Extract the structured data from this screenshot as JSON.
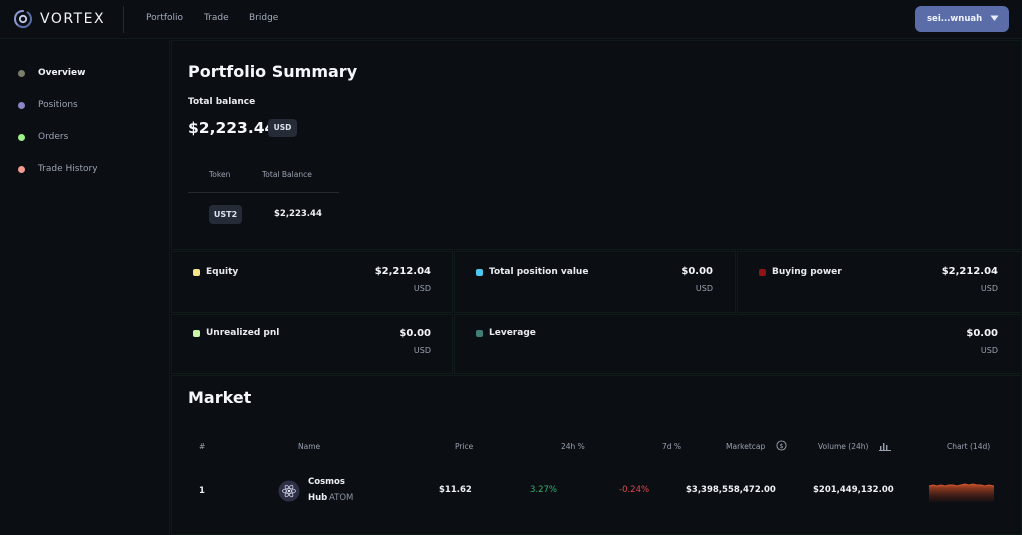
{
  "app": {
    "name": "VORTEX",
    "nav": [
      "Portfolio",
      "Trade",
      "Bridge"
    ],
    "wallet": "sei...wnuah"
  },
  "sidebar": {
    "items": [
      {
        "label": "Overview",
        "color": "#7a7f6a",
        "active": true
      },
      {
        "label": "Positions",
        "color": "#8b86c4",
        "active": false
      },
      {
        "label": "Orders",
        "color": "#9ef08a",
        "active": false
      },
      {
        "label": "Trade History",
        "color": "#f29a92",
        "active": false
      }
    ]
  },
  "summary": {
    "title": "Portfolio Summary",
    "total_label": "Total balance",
    "total_value": "$2,223.44",
    "currency": "USD",
    "table": {
      "headers": [
        "Token",
        "Total Balance"
      ],
      "rows": [
        {
          "token": "UST2",
          "balance": "$2,223.44"
        }
      ]
    }
  },
  "stats": [
    {
      "label": "Equity",
      "value": "$2,212.04",
      "unit": "USD",
      "color": "#f4e48a"
    },
    {
      "label": "Total position value",
      "value": "$0.00",
      "unit": "USD",
      "color": "#4cc9f0"
    },
    {
      "label": "Buying power",
      "value": "$2,212.04",
      "unit": "USD",
      "color": "#8f1414"
    },
    {
      "label": "Unrealized pnl",
      "value": "$0.00",
      "unit": "USD",
      "color": "#c9f7a6"
    },
    {
      "label": "Leverage",
      "value": "$0.00",
      "unit": "USD",
      "color": "#3f7f75"
    }
  ],
  "market": {
    "title": "Market",
    "headers": {
      "rank": "#",
      "name": "Name",
      "price": "Price",
      "change_24h": "24h %",
      "change_7d": "7d %",
      "marketcap": "Marketcap",
      "volume": "Volume (24h)",
      "chart": "Chart (14d)"
    },
    "rows": [
      {
        "rank": "1",
        "name_line1": "Cosmos",
        "name_line2": "Hub",
        "symbol": "ATOM",
        "price": "$11.62",
        "change_24h": "3.27%",
        "change_7d": "-0.24%",
        "marketcap": "$3,398,558,472.00",
        "volume": "$201,449,132.00"
      }
    ]
  }
}
